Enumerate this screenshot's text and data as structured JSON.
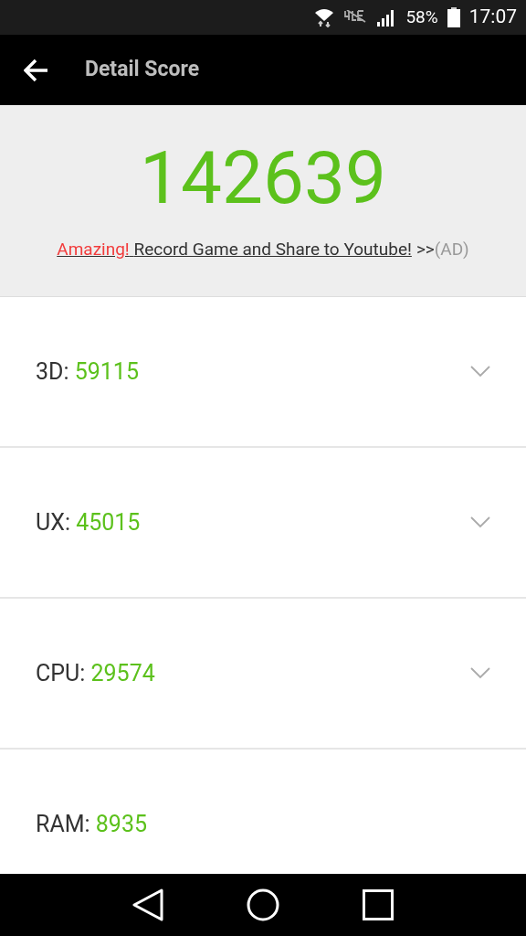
{
  "status_bar": {
    "battery": "58%",
    "time": "17:07"
  },
  "app_bar": {
    "title": "Detail Score"
  },
  "total": {
    "score": "142639",
    "ad": {
      "highlight": "Amazing!",
      "link": "Record Game and Share to Youtube!",
      "arrows": ">>",
      "tag": "(AD)"
    }
  },
  "scores": [
    {
      "label": "3D:",
      "value": "59115",
      "expandable": true
    },
    {
      "label": "UX:",
      "value": "45015",
      "expandable": true
    },
    {
      "label": "CPU:",
      "value": "29574",
      "expandable": true
    },
    {
      "label": "RAM:",
      "value": "8935",
      "expandable": false
    }
  ]
}
